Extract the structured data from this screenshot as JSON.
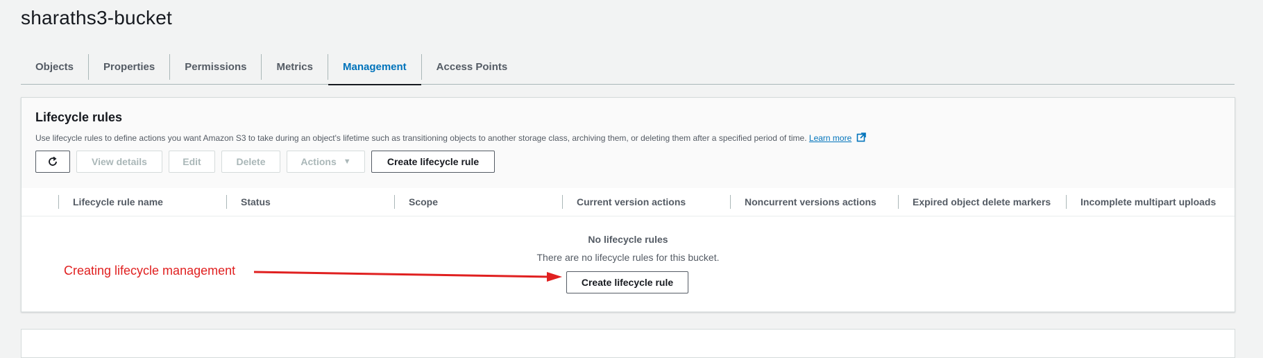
{
  "page": {
    "title": "sharaths3-bucket"
  },
  "tabs": [
    {
      "label": "Objects",
      "active": false
    },
    {
      "label": "Properties",
      "active": false
    },
    {
      "label": "Permissions",
      "active": false
    },
    {
      "label": "Metrics",
      "active": false
    },
    {
      "label": "Management",
      "active": true
    },
    {
      "label": "Access Points",
      "active": false
    }
  ],
  "lifecycle": {
    "title": "Lifecycle rules",
    "description": "Use lifecycle rules to define actions you want Amazon S3 to take during an object's lifetime such as transitioning objects to another storage class, archiving them, or deleting them after a specified period of time.",
    "learn_more": "Learn more",
    "buttons": {
      "refresh_icon": "refresh-icon",
      "view_details": "View details",
      "edit": "Edit",
      "delete": "Delete",
      "actions": "Actions",
      "create": "Create lifecycle rule"
    },
    "columns": [
      "Lifecycle rule name",
      "Status",
      "Scope",
      "Current version actions",
      "Noncurrent versions actions",
      "Expired object delete markers",
      "Incomplete multipart uploads"
    ],
    "empty": {
      "title": "No lifecycle rules",
      "message": "There are no lifecycle rules for this bucket.",
      "button": "Create lifecycle rule"
    }
  },
  "annotation": {
    "text": "Creating lifecycle management",
    "color": "#e02020"
  },
  "colors": {
    "accent": "#0073bb",
    "background": "#f2f3f3"
  }
}
